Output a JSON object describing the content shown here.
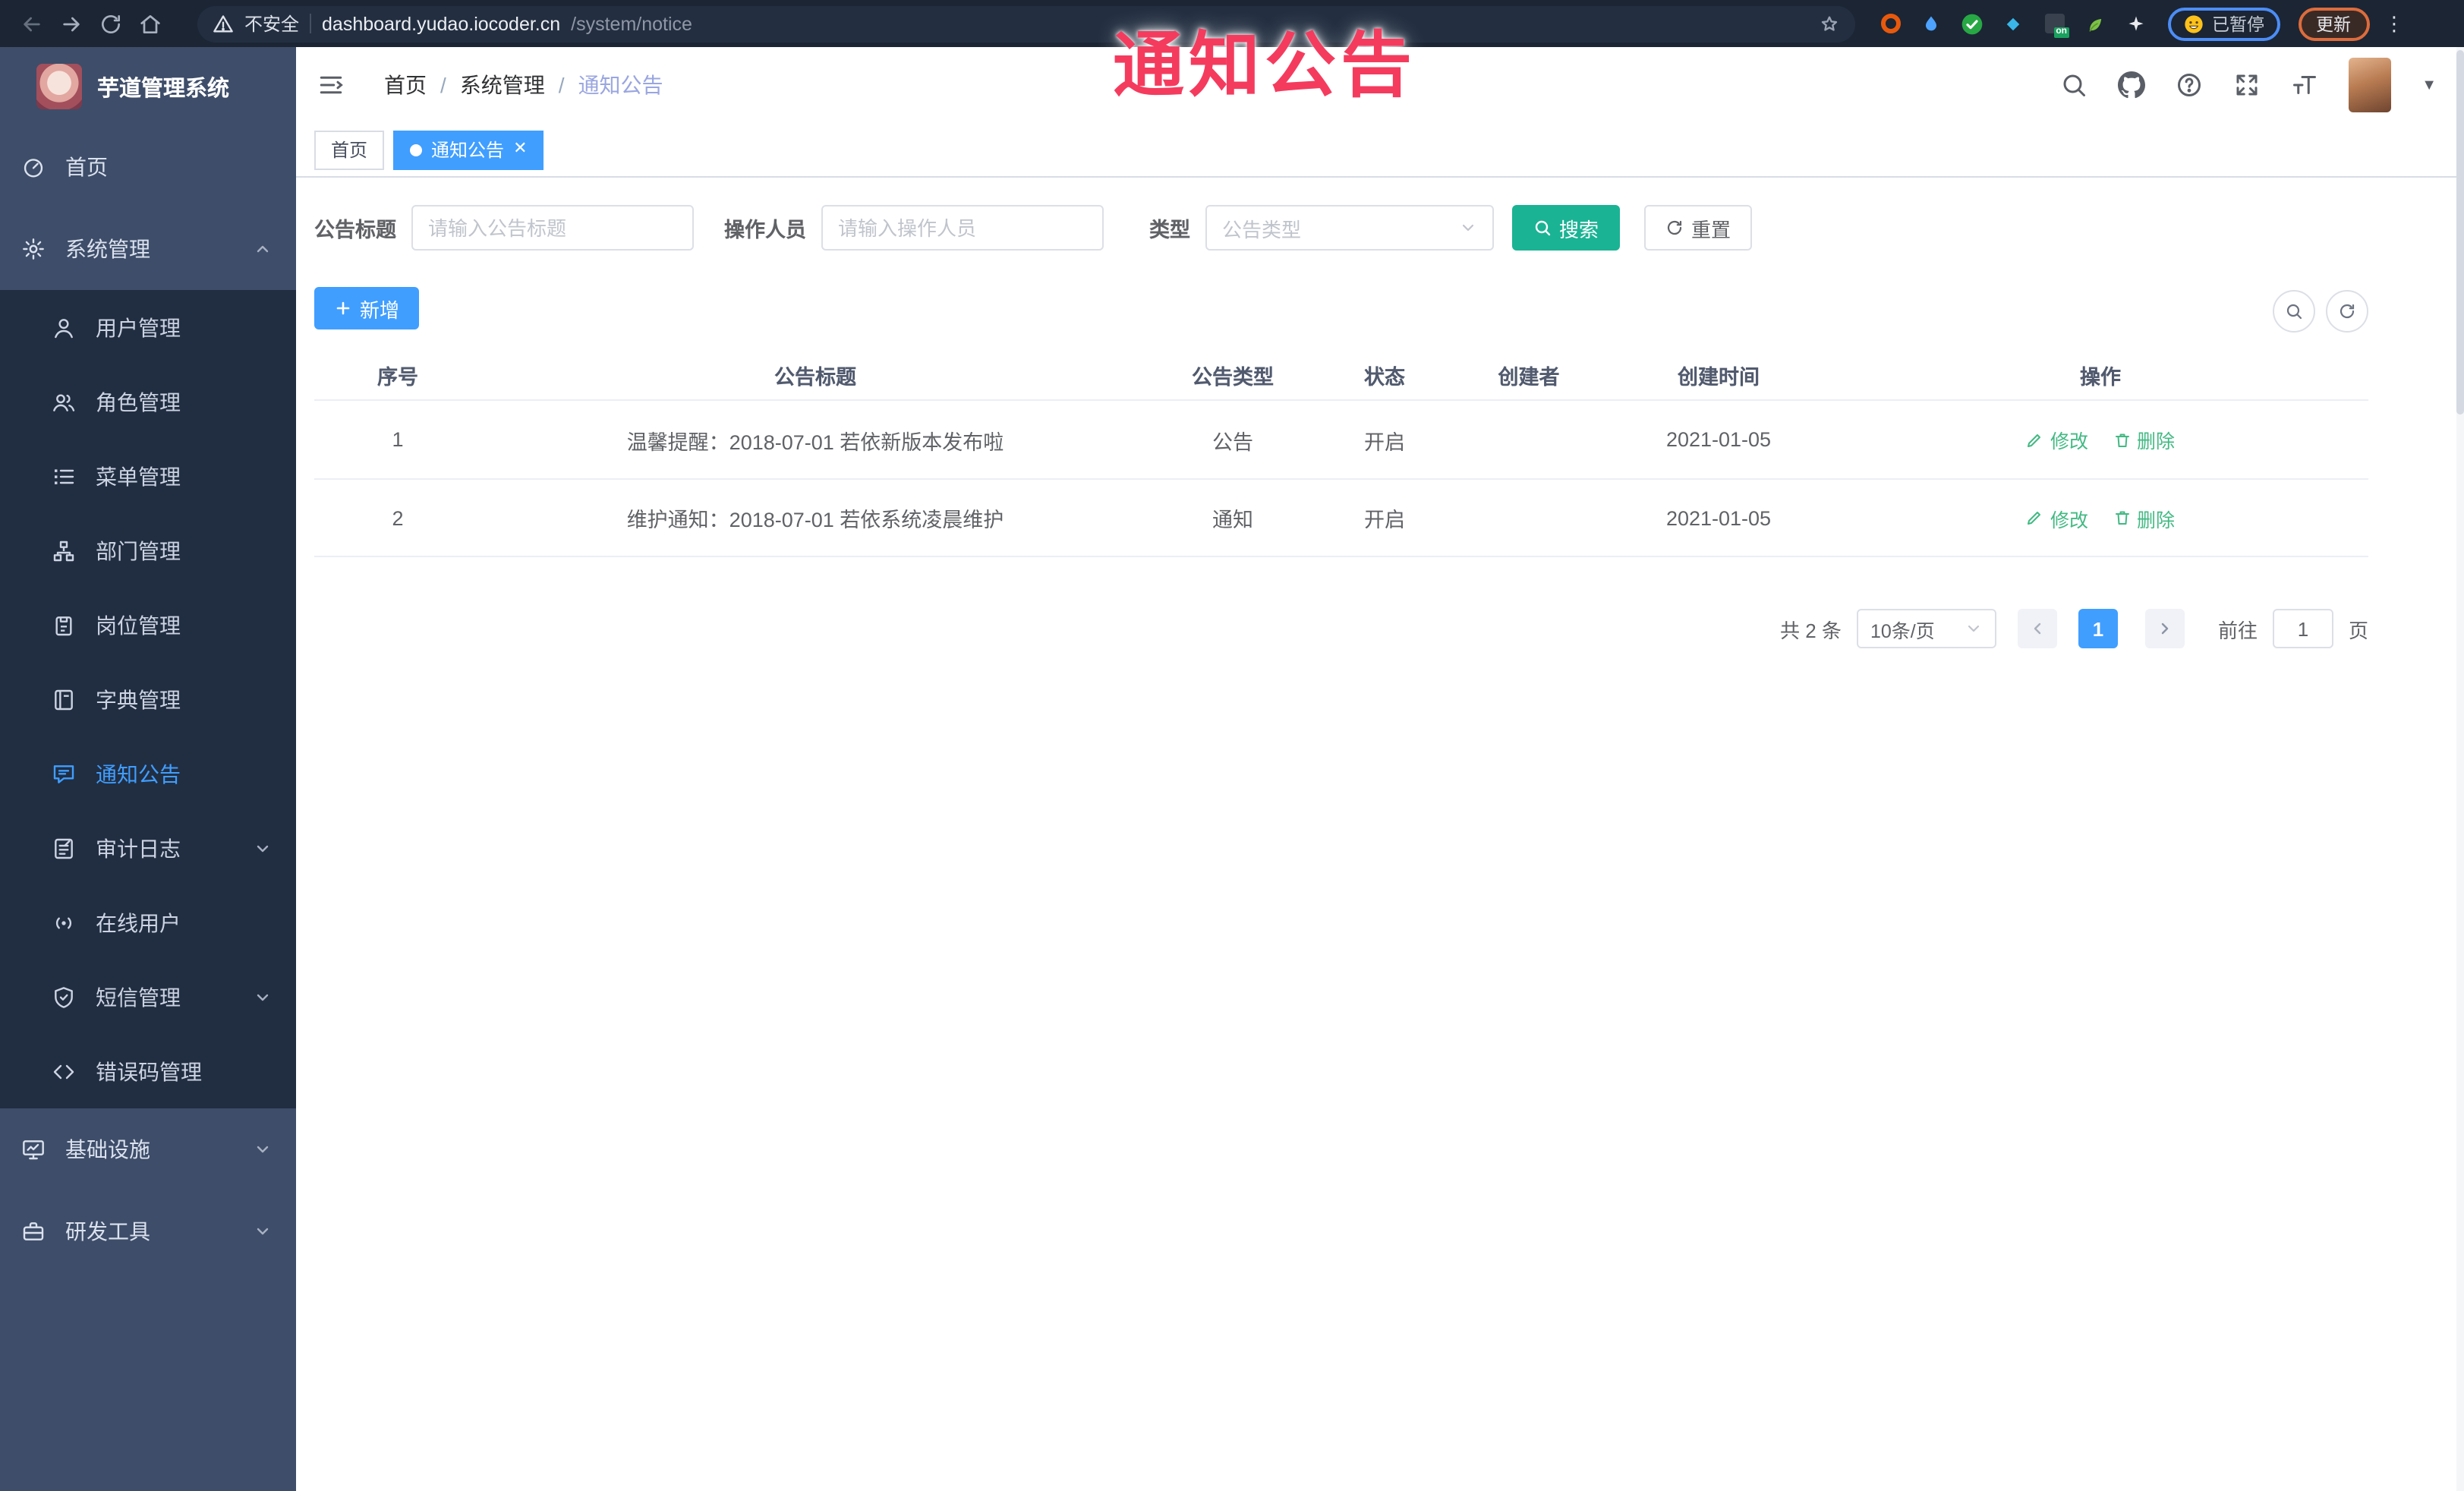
{
  "annotation": {
    "text": "通知公告",
    "color": "#f43b5e"
  },
  "browser": {
    "insecure_label": "不安全",
    "url_host": "dashboard.yudao.iocoder.cn",
    "url_path": "/system/notice",
    "extension_on_badge": "on",
    "paused_chip": "已暂停",
    "update_button": "更新"
  },
  "sidebar": {
    "title": "芋道管理系统",
    "items": [
      {
        "label": "首页",
        "icon": "dashboard-icon"
      },
      {
        "label": "系统管理",
        "icon": "gear-icon",
        "expanded": true
      },
      {
        "label": "用户管理",
        "icon": "user-icon"
      },
      {
        "label": "角色管理",
        "icon": "users-icon"
      },
      {
        "label": "菜单管理",
        "icon": "menu-list-icon"
      },
      {
        "label": "部门管理",
        "icon": "org-tree-icon"
      },
      {
        "label": "岗位管理",
        "icon": "badge-icon"
      },
      {
        "label": "字典管理",
        "icon": "book-icon"
      },
      {
        "label": "通知公告",
        "icon": "message-icon",
        "active": true
      },
      {
        "label": "审计日志",
        "icon": "log-icon",
        "collapsible": true
      },
      {
        "label": "在线用户",
        "icon": "online-icon"
      },
      {
        "label": "短信管理",
        "icon": "shield-icon",
        "collapsible": true
      },
      {
        "label": "错误码管理",
        "icon": "code-icon"
      },
      {
        "label": "基础设施",
        "icon": "monitor-icon",
        "collapsible": true
      },
      {
        "label": "研发工具",
        "icon": "toolbox-icon",
        "collapsible": true
      }
    ]
  },
  "header": {
    "breadcrumb": [
      "首页",
      "系统管理",
      "通知公告"
    ]
  },
  "tabs": [
    {
      "label": "首页",
      "active": false
    },
    {
      "label": "通知公告",
      "active": true
    }
  ],
  "filters": {
    "title_label": "公告标题",
    "title_placeholder": "请输入公告标题",
    "operator_label": "操作人员",
    "operator_placeholder": "请输入操作人员",
    "type_label": "类型",
    "type_placeholder": "公告类型",
    "search_label": "搜索",
    "reset_label": "重置"
  },
  "toolbar": {
    "add_label": "新增"
  },
  "table": {
    "columns": [
      "序号",
      "公告标题",
      "公告类型",
      "状态",
      "创建者",
      "创建时间",
      "操作"
    ],
    "rows": [
      {
        "seq": "1",
        "title": "温馨提醒：2018-07-01 若依新版本发布啦",
        "type": "公告",
        "status": "开启",
        "creator": "",
        "created": "2021-01-05",
        "edit": "修改",
        "delete": "删除"
      },
      {
        "seq": "2",
        "title": "维护通知：2018-07-01 若依系统凌晨维护",
        "type": "通知",
        "status": "开启",
        "creator": "",
        "created": "2021-01-05",
        "edit": "修改",
        "delete": "删除"
      }
    ]
  },
  "pagination": {
    "total": "共 2 条",
    "page_size": "10条/页",
    "current": "1",
    "goto_label": "前往",
    "goto_value": "1",
    "page_label": "页"
  },
  "theme": {
    "primary": "#409eff",
    "search_teal": "#1ab394",
    "action_green": "#42b983",
    "sidebar_bg": "#3e4d69",
    "submenu_bg": "#212e42",
    "browser_bg": "#1b2534",
    "annotation_red": "#f43b5e"
  }
}
